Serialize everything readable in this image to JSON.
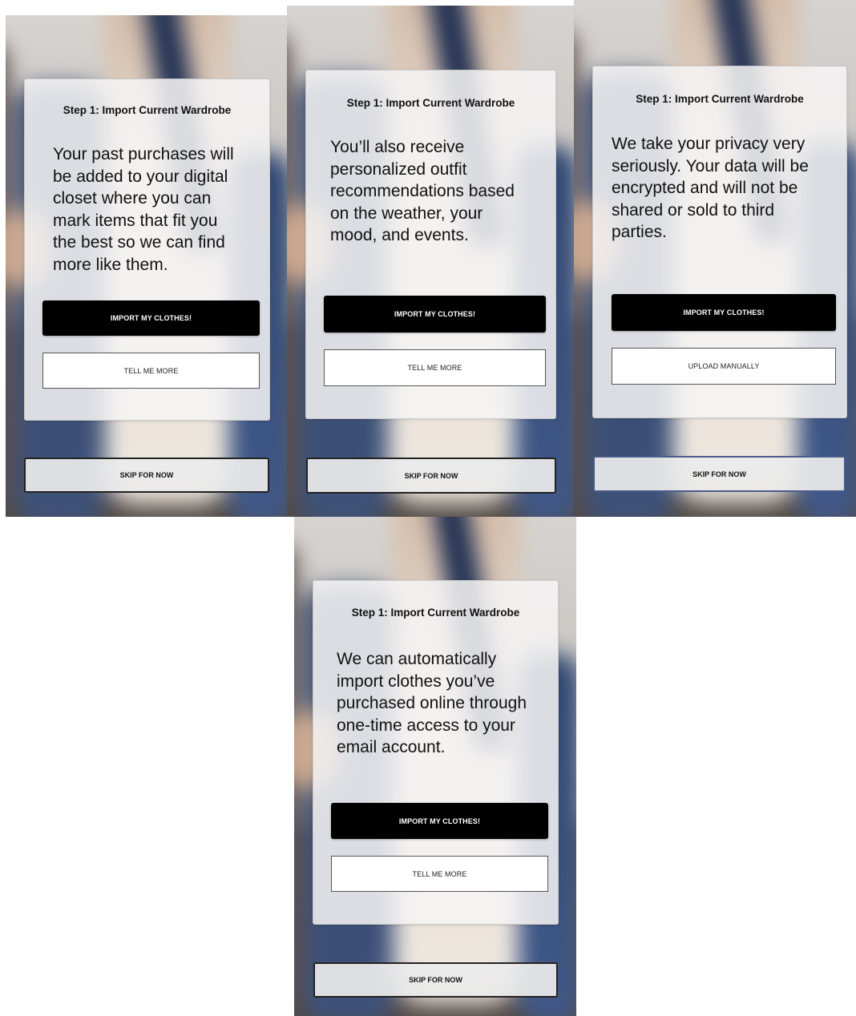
{
  "screens": [
    {
      "step_title": "Step 1: Import Current Wardrobe",
      "body_lines": [
        "Your past purchases will",
        "be added to your digital",
        "closet where you can",
        "mark items that fit you",
        "the best so we can find",
        "more like them."
      ],
      "primary_label": "IMPORT MY CLOTHES!",
      "secondary_label": "TELL ME MORE",
      "skip_label": "SKIP FOR NOW"
    },
    {
      "step_title": "Step 1: Import Current Wardrobe",
      "body_lines": [
        "You’ll also receive",
        "personalized outfit",
        "recommendations based",
        "on the weather, your",
        "mood, and events."
      ],
      "primary_label": "IMPORT MY CLOTHES!",
      "secondary_label": "TELL ME MORE",
      "skip_label": "SKIP FOR NOW"
    },
    {
      "step_title": "Step 1: Import Current Wardrobe",
      "body_lines": [
        "We take your privacy very",
        "seriously. Your data will be",
        "encrypted and will not be",
        "shared or sold to third",
        "parties."
      ],
      "primary_label": "IMPORT MY CLOTHES!",
      "secondary_label": "UPLOAD MANUALLY",
      "skip_label": "SKIP FOR NOW"
    },
    {
      "step_title": "Step 1: Import Current Wardrobe",
      "body_lines": [
        "We can automatically",
        "import clothes you’ve",
        "purchased online through",
        "one-time access to your",
        "email account."
      ],
      "primary_label": "IMPORT MY CLOTHES!",
      "secondary_label": "TELL ME MORE",
      "skip_label": "SKIP FOR NOW"
    }
  ]
}
